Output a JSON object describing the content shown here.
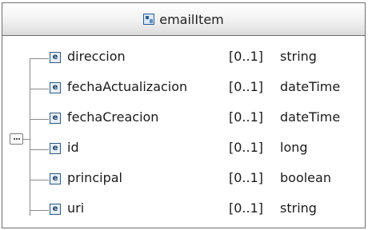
{
  "title": "emailItem",
  "elements": [
    {
      "icon": "e",
      "name": "direccion",
      "cardinality": "[0..1]",
      "type": "string"
    },
    {
      "icon": "e",
      "name": "fechaActualizacion",
      "cardinality": "[0..1]",
      "type": "dateTime"
    },
    {
      "icon": "e",
      "name": "fechaCreacion",
      "cardinality": "[0..1]",
      "type": "dateTime"
    },
    {
      "icon": "e",
      "name": "id",
      "cardinality": "[0..1]",
      "type": "long"
    },
    {
      "icon": "e",
      "name": "principal",
      "cardinality": "[0..1]",
      "type": "boolean"
    },
    {
      "icon": "e",
      "name": "uri",
      "cardinality": "[0..1]",
      "type": "string"
    }
  ]
}
